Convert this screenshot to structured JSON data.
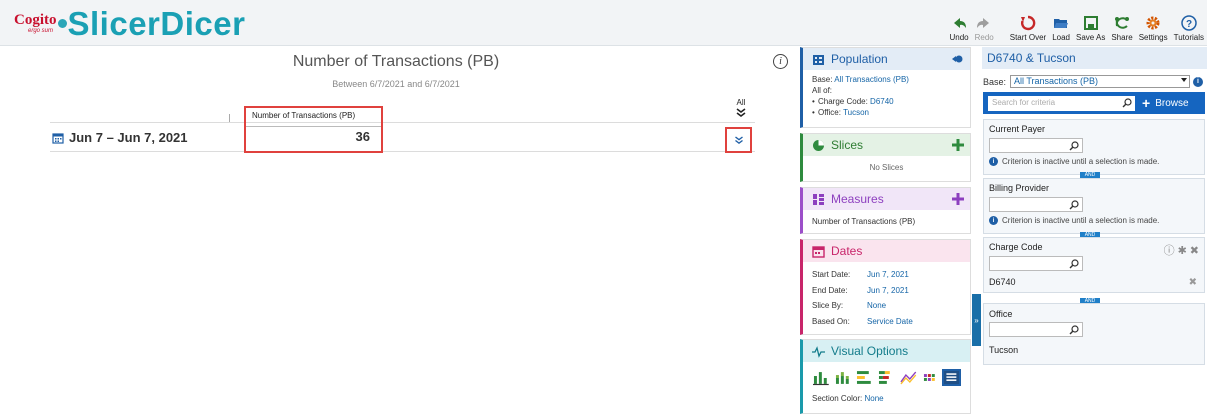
{
  "app": {
    "brand": "Cogito",
    "brand_sub": "ergo sum",
    "name": "SlicerDicer"
  },
  "toolbar": {
    "undo": "Undo",
    "redo": "Redo",
    "start_over": "Start Over",
    "load": "Load",
    "save_as": "Save As",
    "share": "Share",
    "settings": "Settings",
    "tutorials": "Tutorials"
  },
  "report": {
    "title": "Number of Transactions (PB)",
    "subtitle": "Between 6/7/2021 and 6/7/2021",
    "column_header": "Number of Transactions (PB)",
    "all_label": "All",
    "rows": [
      {
        "label": "Jun 7 – Jun 7, 2021",
        "value": "36"
      }
    ]
  },
  "population": {
    "title": "Population",
    "base_label": "Base:",
    "base_value": "All Transactions (PB)",
    "all_of": "All of:",
    "filters": [
      {
        "label": "Charge Code:",
        "value": "D6740"
      },
      {
        "label": "Office:",
        "value": "Tucson"
      }
    ]
  },
  "slices": {
    "title": "Slices",
    "empty": "No Slices"
  },
  "measures": {
    "title": "Measures",
    "items": [
      "Number of Transactions (PB)"
    ]
  },
  "dates": {
    "title": "Dates",
    "rows": [
      {
        "key": "Start Date:",
        "value": "Jun 7, 2021"
      },
      {
        "key": "End Date:",
        "value": "Jun 7, 2021"
      },
      {
        "key": "Slice By:",
        "value": "None"
      },
      {
        "key": "Based On:",
        "value": "Service Date"
      }
    ]
  },
  "visual_options": {
    "title": "Visual Options",
    "section_color_label": "Section Color:",
    "section_color_value": "None"
  },
  "criteria_panel": {
    "title": "D6740 & Tucson",
    "base_label": "Base:",
    "base_value": "All Transactions (PB)",
    "search_placeholder": "Search for criteria",
    "browse": "Browse",
    "and_label": "AND",
    "inactive_note": "Criterion is inactive until a selection is made.",
    "criteria": [
      {
        "title": "Current Payer"
      },
      {
        "title": "Billing Provider"
      },
      {
        "title": "Charge Code",
        "value": "D6740"
      },
      {
        "title": "Office",
        "value": "Tucson"
      }
    ]
  },
  "colors": {
    "accent": "#1aa0b4",
    "highlight": "#e0413d",
    "population": "#1f5fa6",
    "slices": "#2e8b3e",
    "measures": "#9c4fc9",
    "dates": "#c8256a",
    "visual": "#1a9aab"
  }
}
